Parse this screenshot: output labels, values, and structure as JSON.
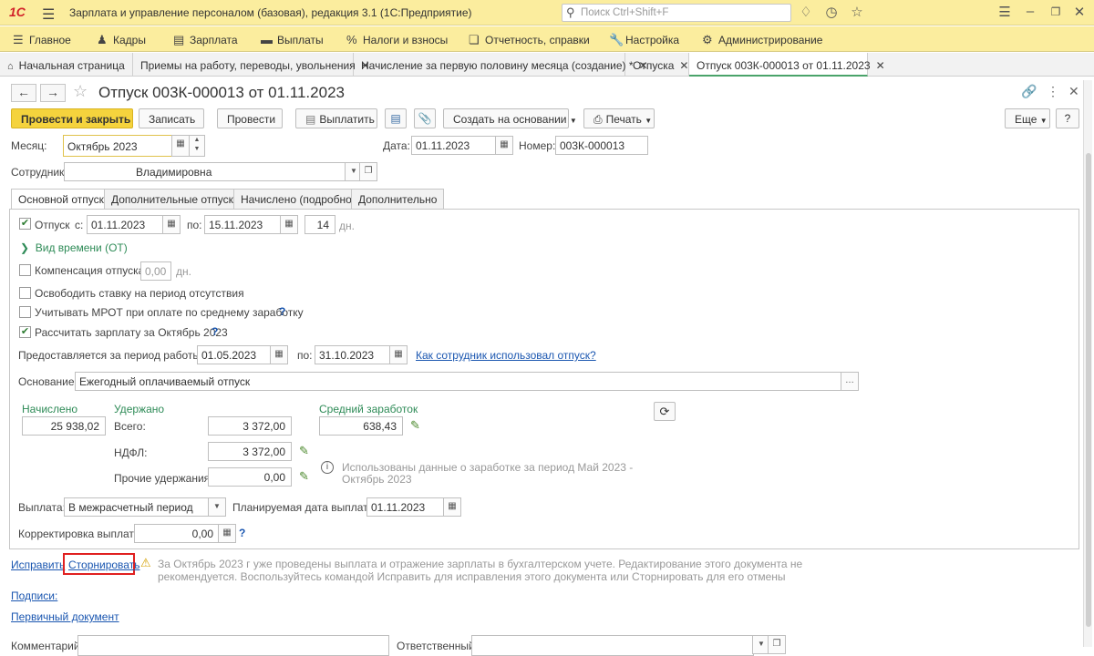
{
  "titlebar": {
    "logo": "1С",
    "menu_icon": "hamburger-icon",
    "title": "Зарплата и управление персоналом (базовая), редакция 3.1  (1С:Предприятие)",
    "search_placeholder": "Поиск Ctrl+Shift+F",
    "icons": [
      "bell-icon",
      "history-icon",
      "star-icon",
      "settings-icon",
      "minimize-icon",
      "restore-icon",
      "close-icon"
    ]
  },
  "menubar": [
    {
      "label": "Главное",
      "icon": "hamburger-icon"
    },
    {
      "label": "Кадры",
      "icon": "people-icon"
    },
    {
      "label": "Зарплата",
      "icon": "list-icon"
    },
    {
      "label": "Выплаты",
      "icon": "wallet-icon"
    },
    {
      "label": "Налоги и взносы",
      "icon": "percent-icon"
    },
    {
      "label": "Отчетность, справки",
      "icon": "copy-icon"
    },
    {
      "label": "Настройка",
      "icon": "wrench-icon"
    },
    {
      "label": "Администрирование",
      "icon": "gear-icon"
    }
  ],
  "window_tabs": [
    {
      "label": "Начальная страница",
      "closable": false
    },
    {
      "label": "Приемы на работу, переводы, увольнения",
      "closable": true
    },
    {
      "label": "Начисление за первую половину месяца (создание) *",
      "closable": true
    },
    {
      "label": "Отпуска",
      "closable": true
    },
    {
      "label": "Отпуск 003К-000013 от 01.11.2023",
      "closable": true,
      "active": true
    }
  ],
  "form": {
    "title": "Отпуск 003К-000013 от 01.11.2023",
    "toolbar": {
      "post_close": "Провести и закрыть",
      "save": "Записать",
      "post": "Провести",
      "pay": "Выплатить",
      "create_based": "Создать на основании",
      "print": "Печать",
      "more": "Еще"
    },
    "month_label": "Месяц:",
    "month_value": "Октябрь 2023",
    "date_label": "Дата:",
    "date_value": "01.11.2023",
    "number_label": "Номер:",
    "number_value": "003К-000013",
    "employee_label": "Сотрудник:",
    "employee_value": "Владимировна",
    "tabs": [
      "Основной отпуск",
      "Дополнительные отпуска",
      "Начислено (подробно)",
      "Дополнительно"
    ],
    "vacation": {
      "label": "Отпуск",
      "from_label": "с:",
      "from": "01.11.2023",
      "to_label": "по:",
      "to": "15.11.2023",
      "days": "14",
      "days_unit": "дн."
    },
    "time_type": "Вид времени (ОТ)",
    "compensation_label": "Компенсация отпуска",
    "compensation_value": "0,00",
    "compensation_unit": "дн.",
    "release_rate": "Освободить ставку на период отсутствия",
    "mrot": "Учитывать МРОТ при оплате по среднему заработку",
    "calc_salary": "Рассчитать зарплату за Октябрь 2023",
    "period_label": "Предоставляется за период работы с:",
    "period_from": "01.05.2023",
    "period_to_label": "по:",
    "period_to": "31.10.2023",
    "period_link": "Как сотрудник использовал отпуск?",
    "basis_label": "Основание:",
    "basis_value": "Ежегодный оплачиваемый отпуск",
    "accrued_title": "Начислено",
    "accrued_value": "25 938,02",
    "withheld_title": "Удержано",
    "total_label": "Всего:",
    "total_value": "3 372,00",
    "ndfl_label": "НДФЛ:",
    "ndfl_value": "3 372,00",
    "other_label": "Прочие удержания:",
    "other_value": "0,00",
    "avg_title": "Средний заработок",
    "avg_value": "638,43",
    "avg_info": "Использованы данные о заработке за период Май 2023 - Октябрь 2023",
    "payout_label": "Выплата:",
    "payout_value": "В межрасчетный период",
    "planned_label": "Планируемая дата выплаты:",
    "planned_value": "01.11.2023",
    "correction_label": "Корректировка выплаты:",
    "correction_value": "0,00"
  },
  "footer": {
    "fix": "Исправить",
    "reverse": "Сторнировать",
    "warning": "За Октябрь 2023 г уже проведены выплата и отражение зарплаты в бухгалтерском учете. Редактирование этого документа не рекомендуется. Воспользуйтесь командой Исправить для исправления этого документа или Сторнировать для его отмены",
    "signatures": "Подписи:",
    "primary_doc": "Первичный документ",
    "comment_label": "Комментарий:",
    "responsible_label": "Ответственный:"
  },
  "colors": {
    "header_bg": "#fbed9e",
    "primary_button": "#f5d33d",
    "accent_green": "#2e8b57",
    "link_blue": "#1a56b0",
    "highlight_red": "#e02020"
  }
}
